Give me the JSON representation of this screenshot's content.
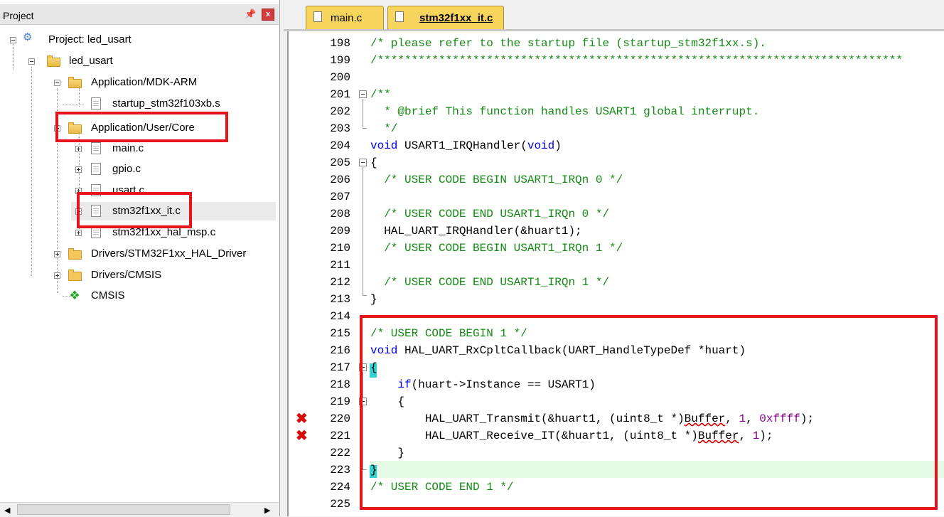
{
  "project_pane": {
    "title": "Project",
    "pin": "ᵖ",
    "close": "x",
    "tree": [
      {
        "label": "Project: led_usart",
        "icon": "project-icon"
      },
      {
        "label": "led_usart",
        "icon": "target-folder-icon"
      },
      {
        "label": "Application/MDK-ARM",
        "icon": "folder-open-icon"
      },
      {
        "label": "startup_stm32f103xb.s",
        "icon": "file-icon"
      },
      {
        "label": "Application/User/Core",
        "icon": "folder-open-icon"
      },
      {
        "label": "main.c",
        "icon": "file-icon"
      },
      {
        "label": "gpio.c",
        "icon": "file-icon"
      },
      {
        "label": "usart.c",
        "icon": "file-icon"
      },
      {
        "label": "stm32f1xx_it.c",
        "icon": "file-icon"
      },
      {
        "label": "stm32f1xx_hal_msp.c",
        "icon": "file-icon"
      },
      {
        "label": "Drivers/STM32F1xx_HAL_Driver",
        "icon": "folder-icon"
      },
      {
        "label": "Drivers/CMSIS",
        "icon": "folder-icon"
      },
      {
        "label": "CMSIS",
        "icon": "cmsis-diamond-icon"
      }
    ],
    "scroll_left": "◀",
    "scroll_right": "▶"
  },
  "editor": {
    "tabs": [
      {
        "label": "main.c",
        "active": false
      },
      {
        "label": "stm32f1xx_it.c",
        "active": true
      }
    ],
    "line_numbers": [
      "198",
      "199",
      "200",
      "201",
      "202",
      "203",
      "204",
      "205",
      "206",
      "207",
      "208",
      "209",
      "210",
      "211",
      "212",
      "213",
      "214",
      "215",
      "216",
      "217",
      "218",
      "219",
      "220",
      "221",
      "222",
      "223",
      "224",
      "225"
    ],
    "error_marker": "✖",
    "code": {
      "l198": "/* please refer to the startup file (startup_stm32f1xx.s).",
      "l199": "/*****************************************************************************",
      "l201": "/**",
      "l202": "  * @brief This function handles USART1 global interrupt.",
      "l203": "  */",
      "l204_kw": "void",
      "l204_rest": " USART1_IRQHandler(",
      "l204_arg": "void",
      "l204_end": ")",
      "l205": "{",
      "l206": "  /* USER CODE BEGIN USART1_IRQn 0 */",
      "l208": "  /* USER CODE END USART1_IRQn 0 */",
      "l209": "  HAL_UART_IRQHandler(&huart1);",
      "l210": "  /* USER CODE BEGIN USART1_IRQn 1 */",
      "l212": "  /* USER CODE END USART1_IRQn 1 */",
      "l213": "}",
      "l215": "/* USER CODE BEGIN 1 */",
      "l216_kw": "void",
      "l216_rest": " HAL_UART_RxCpltCallback(UART_HandleTypeDef *huart)",
      "l217": "{",
      "l218_indent": "    ",
      "l218_kw": "if",
      "l218_rest": "(huart->Instance == USART1)",
      "l219": "    {",
      "l220_a": "        HAL_UART_Transmit(&huart1, (uint8_t *)",
      "l220_err": "Buffer",
      "l220_b": ", ",
      "l220_n1": "1",
      "l220_c": ", ",
      "l220_n2": "0xffff",
      "l220_d": ");",
      "l221_a": "        HAL_UART_Receive_IT(&huart1, (uint8_t *)",
      "l221_err": "Buffer",
      "l221_b": ", ",
      "l221_n1": "1",
      "l221_d": ");",
      "l222": "    }",
      "l223": "}",
      "l224": "/* USER CODE END 1 */"
    }
  },
  "colors": {
    "comment": "#138a13",
    "keyword": "#0000e8",
    "number": "#8b008b",
    "annotation_box": "#e8141d",
    "tab": "#f7d55d",
    "current_line": "#e6fbe6"
  }
}
